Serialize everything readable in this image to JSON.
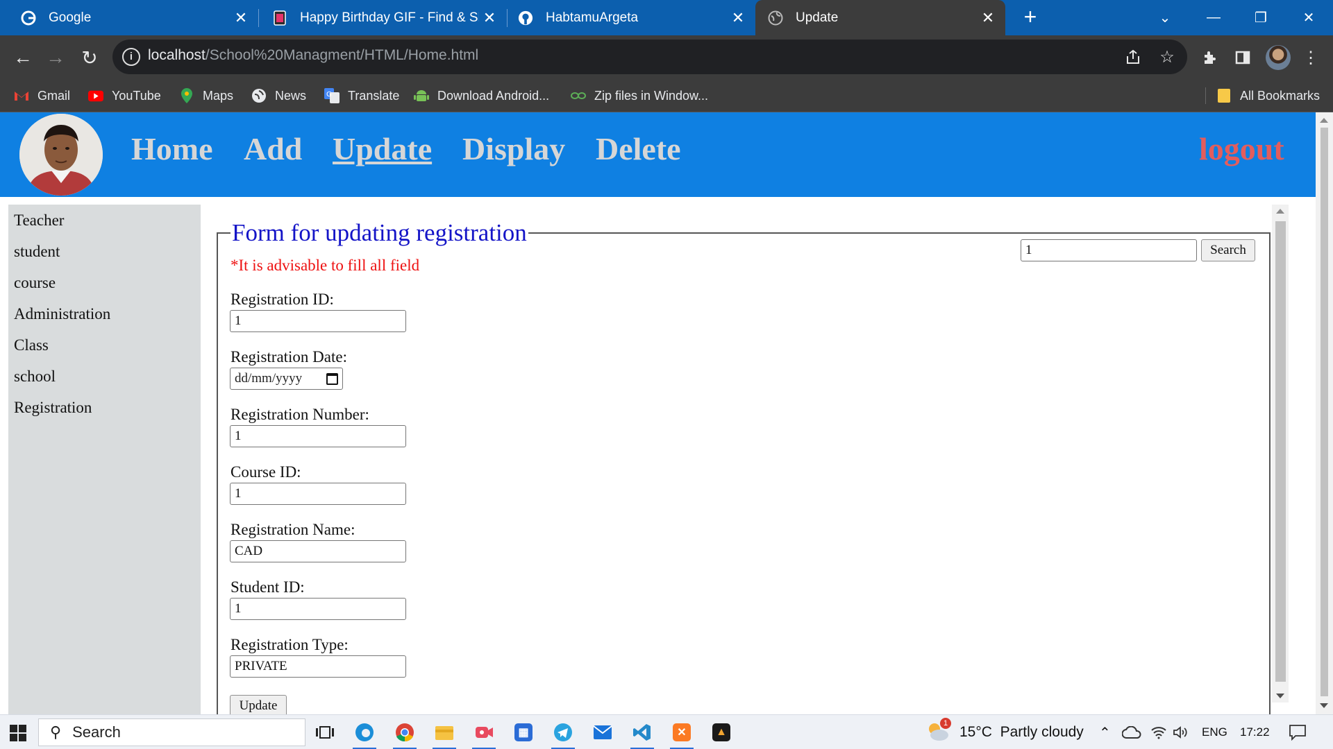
{
  "browser": {
    "tabs": [
      {
        "title": "Google",
        "favicon": "google-icon"
      },
      {
        "title": "Happy Birthday GIF - Find & Sha",
        "favicon": "document-icon"
      },
      {
        "title": "HabtamuArgeta",
        "favicon": "github-icon"
      },
      {
        "title": "Update",
        "favicon": "globe-icon",
        "active": true
      }
    ],
    "new_tab": "+",
    "window_controls": {
      "tab_search": "⌄",
      "minimize": "—",
      "restore": "❐",
      "close": "✕"
    },
    "url_host": "localhost",
    "url_path": "/School%20Managment/HTML/Home.html",
    "bookmarks": [
      {
        "label": "Gmail",
        "icon": "gmail-icon"
      },
      {
        "label": "YouTube",
        "icon": "youtube-icon"
      },
      {
        "label": "Maps",
        "icon": "maps-icon"
      },
      {
        "label": "News",
        "icon": "news-icon"
      },
      {
        "label": "Translate",
        "icon": "translate-icon"
      },
      {
        "label": "Download Android...",
        "icon": "android-icon"
      },
      {
        "label": "Zip files in Window...",
        "icon": "link-icon"
      }
    ],
    "all_bookmarks": "All Bookmarks"
  },
  "nav": {
    "links": [
      "Home",
      "Add",
      "Update",
      "Display",
      "Delete"
    ],
    "current": "Update",
    "logout": "logout"
  },
  "sidebar": {
    "items": [
      "Teacher",
      "student",
      "course",
      "Administration",
      "Class",
      "school",
      "Registration"
    ]
  },
  "form": {
    "legend": "Form for updating registration",
    "warning": "*It is advisable to fill all field",
    "search_value": "1",
    "search_button": "Search",
    "fields": [
      {
        "label": "Registration ID:",
        "value": "1"
      },
      {
        "label": "Registration Date:",
        "value": "dd/mm/yyyy"
      },
      {
        "label": "Registration Number:",
        "value": "1"
      },
      {
        "label": "Course ID:",
        "value": "1"
      },
      {
        "label": "Registration Name:",
        "value": "CAD"
      },
      {
        "label": "Student ID:",
        "value": "1"
      },
      {
        "label": "Registration Type:",
        "value": "PRIVATE"
      }
    ],
    "submit": "Update"
  },
  "taskbar": {
    "search_label": "Search",
    "weather": "15°C  Partly cloudy",
    "weather_badge": "1",
    "language": "ENG",
    "time": "17:22"
  },
  "colors": {
    "nav_bg": "#0f80e2",
    "logout": "#e35d5d",
    "legend": "#1414c7",
    "warning": "#e11111"
  }
}
